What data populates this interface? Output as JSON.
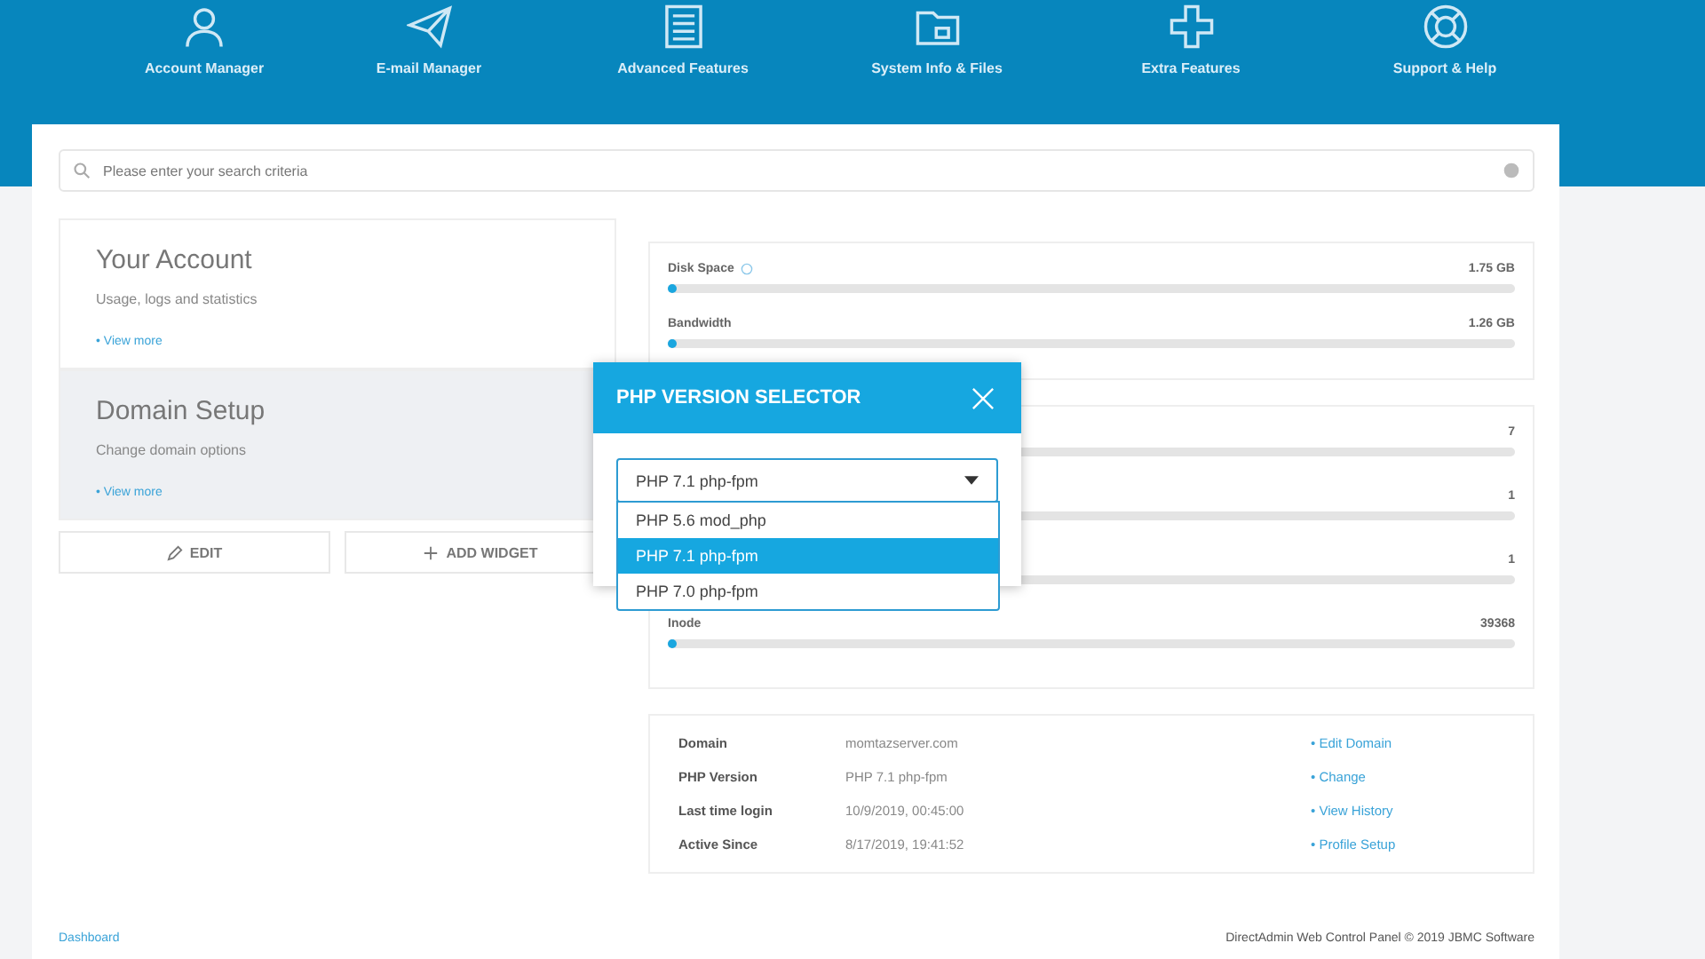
{
  "nav": [
    {
      "label": "Account Manager",
      "kind": "user"
    },
    {
      "label": "E-mail Manager",
      "kind": "plane"
    },
    {
      "label": "Advanced Features",
      "kind": "doc"
    },
    {
      "label": "System Info & Files",
      "kind": "folder"
    },
    {
      "label": "Extra Features",
      "kind": "plus"
    },
    {
      "label": "Support & Help",
      "kind": "buoy"
    }
  ],
  "search": {
    "placeholder": "Please enter your search criteria"
  },
  "cards": [
    {
      "title": "Your Account",
      "subtitle": "Usage, logs and statistics",
      "link": "• View more",
      "selected": false
    },
    {
      "title": "Domain Setup",
      "subtitle": "Change domain options",
      "link": "• View more",
      "selected": true
    }
  ],
  "buttons": [
    {
      "label": "EDIT",
      "kind": "edit"
    },
    {
      "label": "ADD WIDGET",
      "kind": "add"
    }
  ],
  "usage": [
    {
      "label": "Disk Space",
      "value": "1.75 GB",
      "level": 0.01,
      "info": true
    },
    {
      "label": "Bandwidth",
      "value": "1.26 GB",
      "level": 0.01,
      "info": false
    }
  ],
  "counts": [
    {
      "value": "7",
      "level": 0.01
    },
    {
      "value": "1",
      "level": 0.01
    },
    {
      "value": "1",
      "level": 0.01
    },
    {
      "label": "Inode",
      "value": "39368",
      "level": 0.01
    }
  ],
  "details": [
    {
      "label": "Domain",
      "value": "momtazserver.com",
      "link": "• Edit Domain"
    },
    {
      "label": "PHP Version",
      "value": "PHP 7.1 php-fpm",
      "link": "• Change"
    },
    {
      "label": "Last time login",
      "value": "10/9/2019, 00:45:00",
      "link": "• View History"
    },
    {
      "label": "Active Since",
      "value": "8/17/2019, 19:41:52",
      "link": "• Profile Setup"
    }
  ],
  "footer": {
    "link": "Dashboard",
    "copyright": "DirectAdmin Web Control Panel © 2019 JBMC Software"
  },
  "modal": {
    "title": "PHP VERSION SELECTOR",
    "value": "PHP 7.1 php-fpm",
    "options": [
      {
        "label": "PHP 5.6 mod_php",
        "selected": false
      },
      {
        "label": "PHP 7.1 php-fpm",
        "selected": true
      },
      {
        "label": "PHP 7.0 php-fpm",
        "selected": false
      }
    ]
  }
}
